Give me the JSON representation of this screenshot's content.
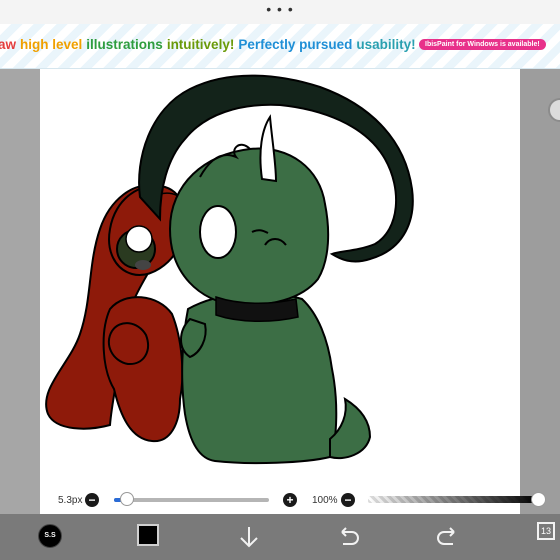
{
  "top_bar": {
    "more_label": "• • •"
  },
  "banner": {
    "words": [
      "aw",
      "high level",
      "illustrations",
      "intuitively!",
      "Perfectly pursued",
      "usability!"
    ],
    "badge": "IbisPaint for Windows is available!"
  },
  "controls": {
    "brush_size_label": "5.3px",
    "brush_size_fraction": 0.05,
    "opacity_label": "100%",
    "opacity_fraction": 1.0,
    "minus_symbol": "−",
    "plus_symbol": "+"
  },
  "toolbar": {
    "brush_preview_text": "S.S",
    "current_color": "#000000",
    "layer_count": "13",
    "icons": [
      "brush-preview-icon",
      "color-swatch",
      "down-arrow-icon",
      "undo-icon",
      "redo-icon",
      "layers-icon"
    ]
  },
  "colors": {
    "accent": "#2a6bd6",
    "toolbar_bg": "#7a7a7a",
    "character_green": "#3c6e45",
    "character_red": "#8e1a0a"
  }
}
